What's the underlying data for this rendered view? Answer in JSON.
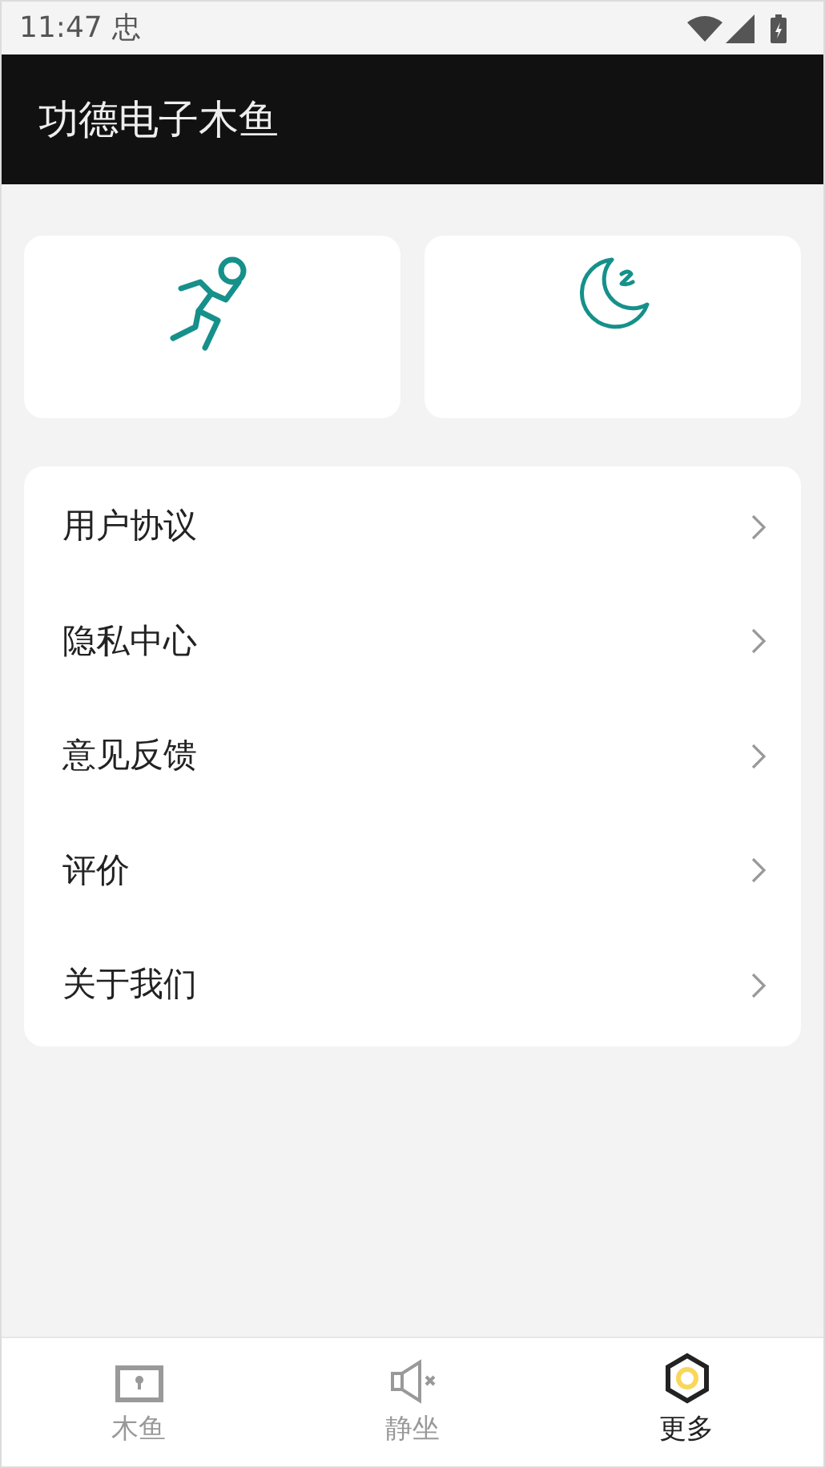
{
  "status_bar": {
    "time": "11:47",
    "notification": "忠"
  },
  "app_bar": {
    "title": "功德电子木鱼"
  },
  "shortcuts": [
    {
      "kind": "running"
    },
    {
      "kind": "sleep"
    }
  ],
  "menu": [
    {
      "label": "用户协议"
    },
    {
      "label": "隐私中心"
    },
    {
      "label": "意见反馈"
    },
    {
      "label": "评价"
    },
    {
      "label": "关于我们"
    }
  ],
  "tabs": [
    {
      "label": "木鱼",
      "kind": "frame",
      "selected": false
    },
    {
      "label": "静坐",
      "kind": "mute",
      "selected": false
    },
    {
      "label": "更多",
      "kind": "hexagon",
      "selected": true
    }
  ]
}
